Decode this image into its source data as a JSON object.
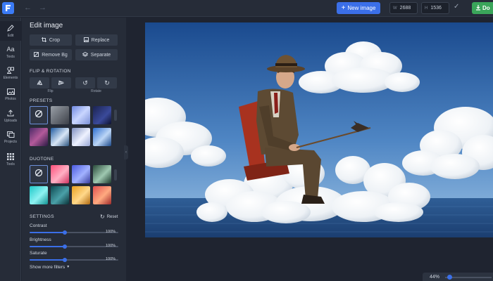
{
  "topbar": {
    "new_image_label": "New image",
    "width_label": "W",
    "width_value": "2688",
    "height_label": "H",
    "height_value": "1536",
    "download_label": "Do"
  },
  "leftnav": {
    "items": [
      {
        "label": "Edit",
        "icon": "pencil-icon"
      },
      {
        "label": "Texts",
        "icon": "text-icon"
      },
      {
        "label": "Elements",
        "icon": "shapes-icon"
      },
      {
        "label": "Photos",
        "icon": "image-icon"
      },
      {
        "label": "Uploads",
        "icon": "upload-icon"
      },
      {
        "label": "Projects",
        "icon": "folder-icon"
      },
      {
        "label": "Tools",
        "icon": "grid-icon"
      }
    ]
  },
  "panel": {
    "title": "Edit image",
    "crop_label": "Crop",
    "replace_label": "Replace",
    "remove_bg_label": "Remove Bg",
    "separate_label": "Separate",
    "flip_rotation_title": "FLIP & ROTATION",
    "flip_label": "Flip",
    "rotate_label": "Rotate",
    "presets_title": "PRESETS",
    "duotone_title": "DUOTONE",
    "settings_title": "SETTINGS",
    "reset_label": "Reset",
    "show_more_label": "Show more filters",
    "sliders": [
      {
        "label": "Contrast",
        "value": "100%",
        "fraction": 0.4
      },
      {
        "label": "Brightness",
        "value": "100%",
        "fraction": 0.4
      },
      {
        "label": "Saturate",
        "value": "100%",
        "fraction": 0.4
      }
    ]
  },
  "zoom": {
    "label": "44%",
    "fraction": 0.05
  },
  "colors": {
    "accent": "#3b6fe8",
    "download": "#3aa55a",
    "panel_bg": "#262c38"
  }
}
